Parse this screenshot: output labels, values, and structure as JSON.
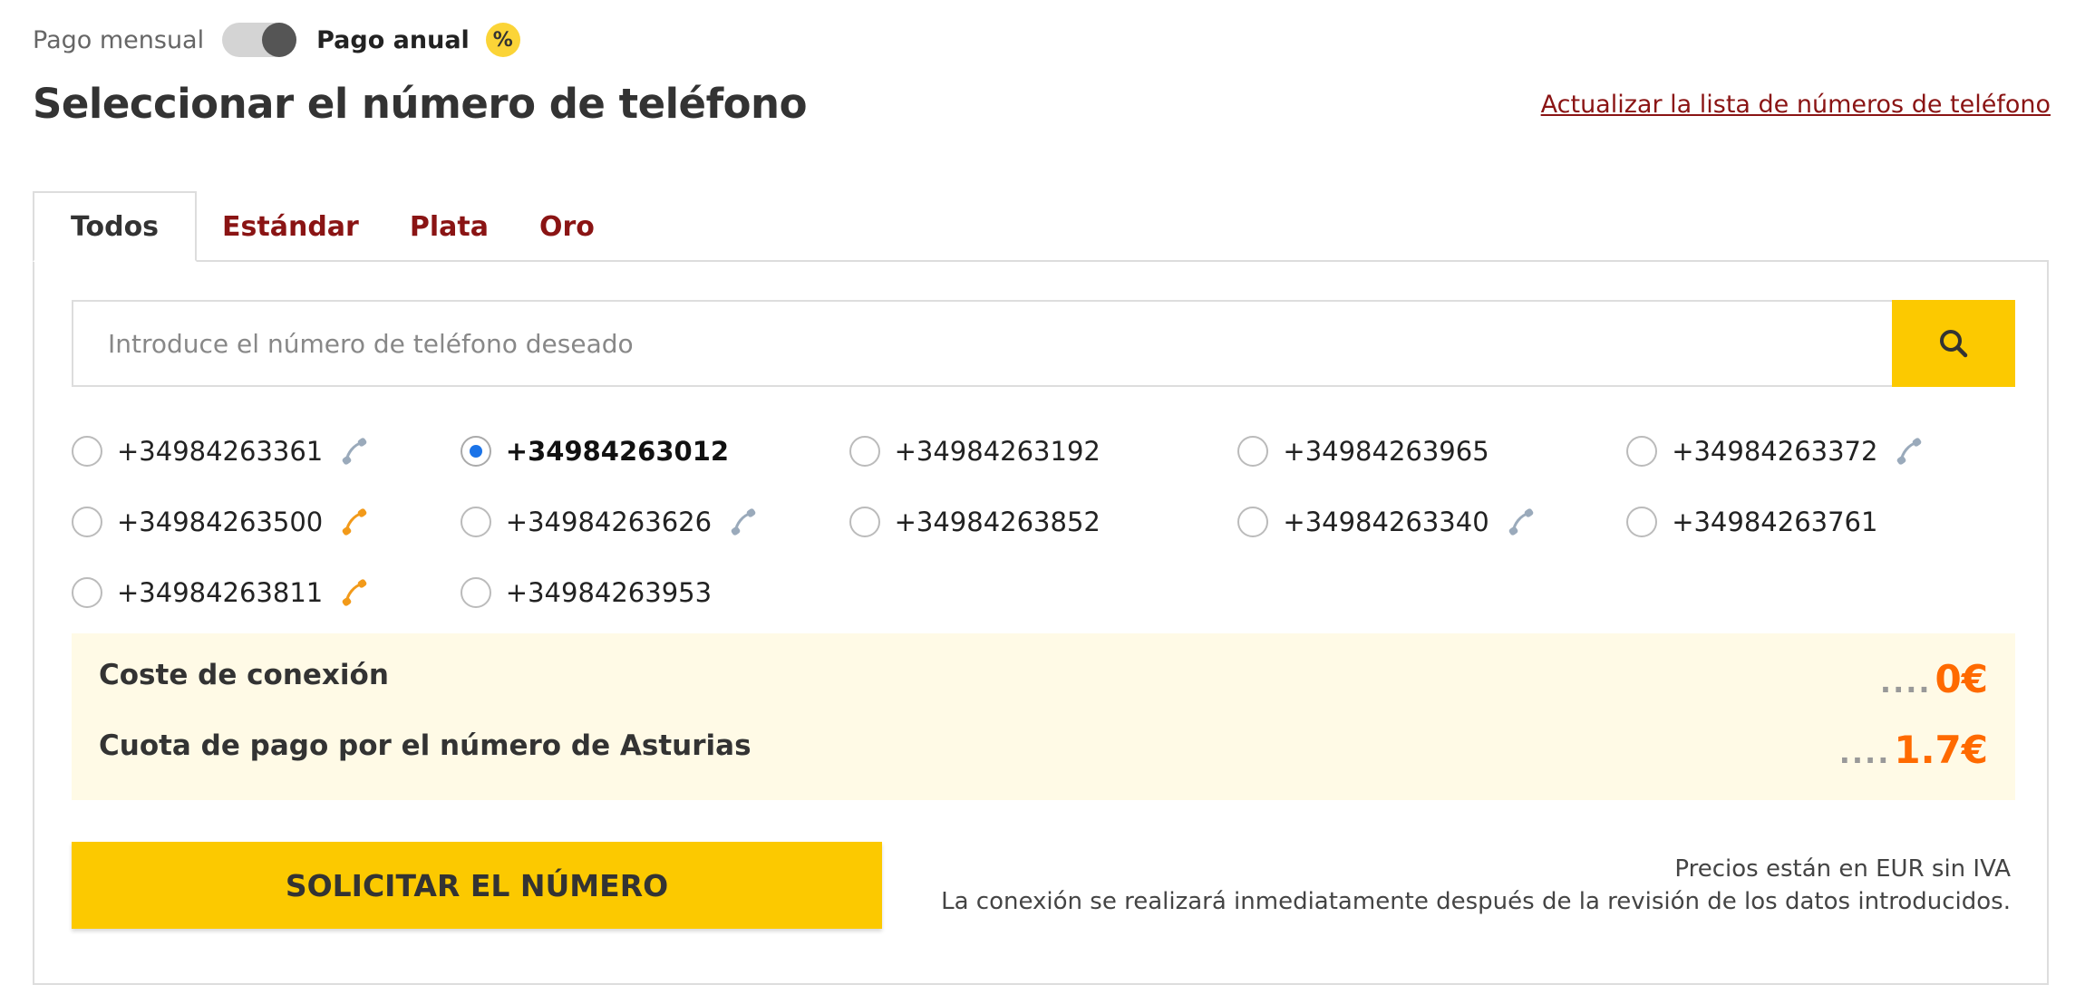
{
  "billing": {
    "monthly_label": "Pago mensual",
    "annual_label": "Pago anual",
    "discount_symbol": "%"
  },
  "header": {
    "title": "Seleccionar el número de teléfono",
    "refresh_link": "Actualizar la lista de números de teléfono"
  },
  "tabs": [
    {
      "label": "Todos",
      "active": true
    },
    {
      "label": "Estándar",
      "active": false
    },
    {
      "label": "Plata",
      "active": false
    },
    {
      "label": "Oro",
      "active": false
    }
  ],
  "search": {
    "value": "",
    "placeholder": "Introduce el número de teléfono deseado"
  },
  "numbers": [
    {
      "number": "+34984263361",
      "selected": false,
      "icon": "gray"
    },
    {
      "number": "+34984263012",
      "selected": true,
      "icon": ""
    },
    {
      "number": "+34984263192",
      "selected": false,
      "icon": ""
    },
    {
      "number": "+34984263965",
      "selected": false,
      "icon": ""
    },
    {
      "number": "+34984263372",
      "selected": false,
      "icon": "gray"
    },
    {
      "number": "+34984263500",
      "selected": false,
      "icon": "orange"
    },
    {
      "number": "+34984263626",
      "selected": false,
      "icon": "gray"
    },
    {
      "number": "+34984263852",
      "selected": false,
      "icon": ""
    },
    {
      "number": "+34984263340",
      "selected": false,
      "icon": "gray"
    },
    {
      "number": "+34984263761",
      "selected": false,
      "icon": ""
    },
    {
      "number": "+34984263811",
      "selected": false,
      "icon": "orange"
    },
    {
      "number": "+34984263953",
      "selected": false,
      "icon": ""
    }
  ],
  "costs": {
    "connection_label": "Coste de conexión",
    "connection_value": "0€",
    "fee_label": "Cuota de pago por el número de Asturias",
    "fee_value": "1.7€",
    "dots": "...."
  },
  "actions": {
    "order_label": "SOLICITAR EL NÚMERO"
  },
  "notes": {
    "line1": "Precios están en EUR sin IVA",
    "line2": "La conexión se realizará inmediatamente después de la revisión de los datos introducidos."
  },
  "colors": {
    "accent": "#fcc900",
    "link": "#8a1414",
    "price": "#ff6a00",
    "radio_selected": "#1a73e8",
    "phone_icon_gray": "#9aaabb",
    "phone_icon_orange": "#f29a1a"
  }
}
